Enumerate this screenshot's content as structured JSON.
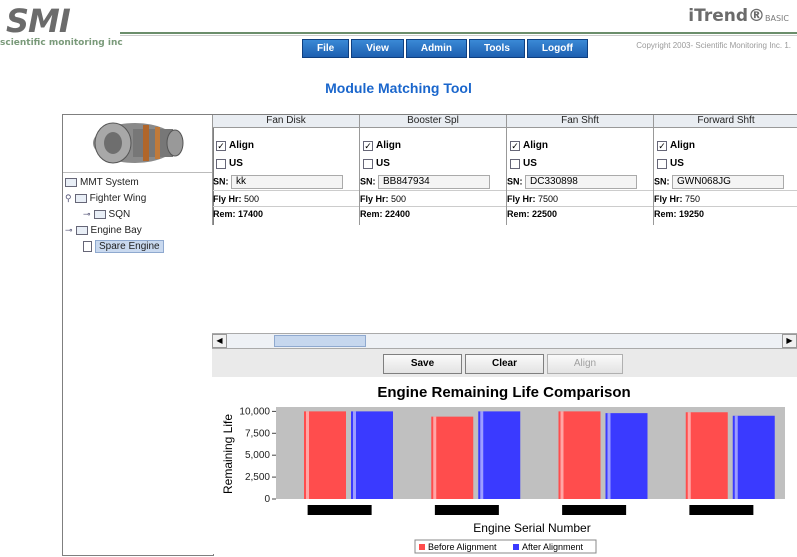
{
  "header": {
    "logo_text": "SMI",
    "logo_subtitle": "scientific monitoring inc",
    "brand": "iTrend®",
    "brand_suffix": "BASIC",
    "copyright": "Copyright 2003- Scientific Monitoring Inc. 1."
  },
  "nav": [
    "File",
    "View",
    "Admin",
    "Tools",
    "Logoff"
  ],
  "app_title": "Module Matching Tool",
  "tree": {
    "root": "MMT System",
    "items": [
      {
        "label": "Fighter Wing",
        "type": "folder"
      },
      {
        "label": "SQN",
        "type": "folder"
      },
      {
        "label": "Engine Bay",
        "type": "folder"
      },
      {
        "label": "Spare Engine",
        "type": "doc",
        "selected": true
      }
    ]
  },
  "modules": [
    {
      "name": "Fan Disk",
      "align": "Align",
      "us": "US",
      "sn_label": "SN:",
      "sn": "kk",
      "fly_label": "Fly Hr:",
      "fly": "500",
      "rem_label": "Rem:",
      "rem": "17400"
    },
    {
      "name": "Booster Spl",
      "align": "Align",
      "us": "US",
      "sn_label": "SN:",
      "sn": "BB847934",
      "fly_label": "Fly Hr:",
      "fly": "500",
      "rem_label": "Rem:",
      "rem": "22400"
    },
    {
      "name": "Fan Shft",
      "align": "Align",
      "us": "US",
      "sn_label": "SN:",
      "sn": "DC330898",
      "fly_label": "Fly Hr:",
      "fly": "7500",
      "rem_label": "Rem:",
      "rem": "22500"
    },
    {
      "name": "Forward Shft",
      "align": "Align",
      "us": "US",
      "sn_label": "SN:",
      "sn": "GWN068JG",
      "fly_label": "Fly Hr:",
      "fly": "750",
      "rem_label": "Rem:",
      "rem": "19250"
    }
  ],
  "buttons": {
    "save": "Save",
    "clear": "Clear",
    "align": "Align"
  },
  "colors": {
    "before": "#ff4d4d",
    "after": "#3a3aff",
    "plot_bg": "#c0c0c0"
  },
  "chart_data": {
    "type": "bar",
    "title": "Engine Remaining Life Comparison",
    "xlabel": "Engine Serial Number",
    "ylabel": "Remaining Life",
    "ylim": [
      0,
      10500
    ],
    "yticks": [
      "0",
      "2,500",
      "5,000",
      "7,500",
      "10,000"
    ],
    "ytick_values": [
      0,
      2500,
      5000,
      7500,
      10000
    ],
    "categories": [
      "",
      "",
      "",
      ""
    ],
    "series": [
      {
        "name": "Before Alignment",
        "values": [
          10000,
          9400,
          10000,
          9900
        ]
      },
      {
        "name": "After Alignment",
        "values": [
          10000,
          10000,
          9800,
          9500
        ]
      }
    ],
    "legend": "bottom"
  }
}
